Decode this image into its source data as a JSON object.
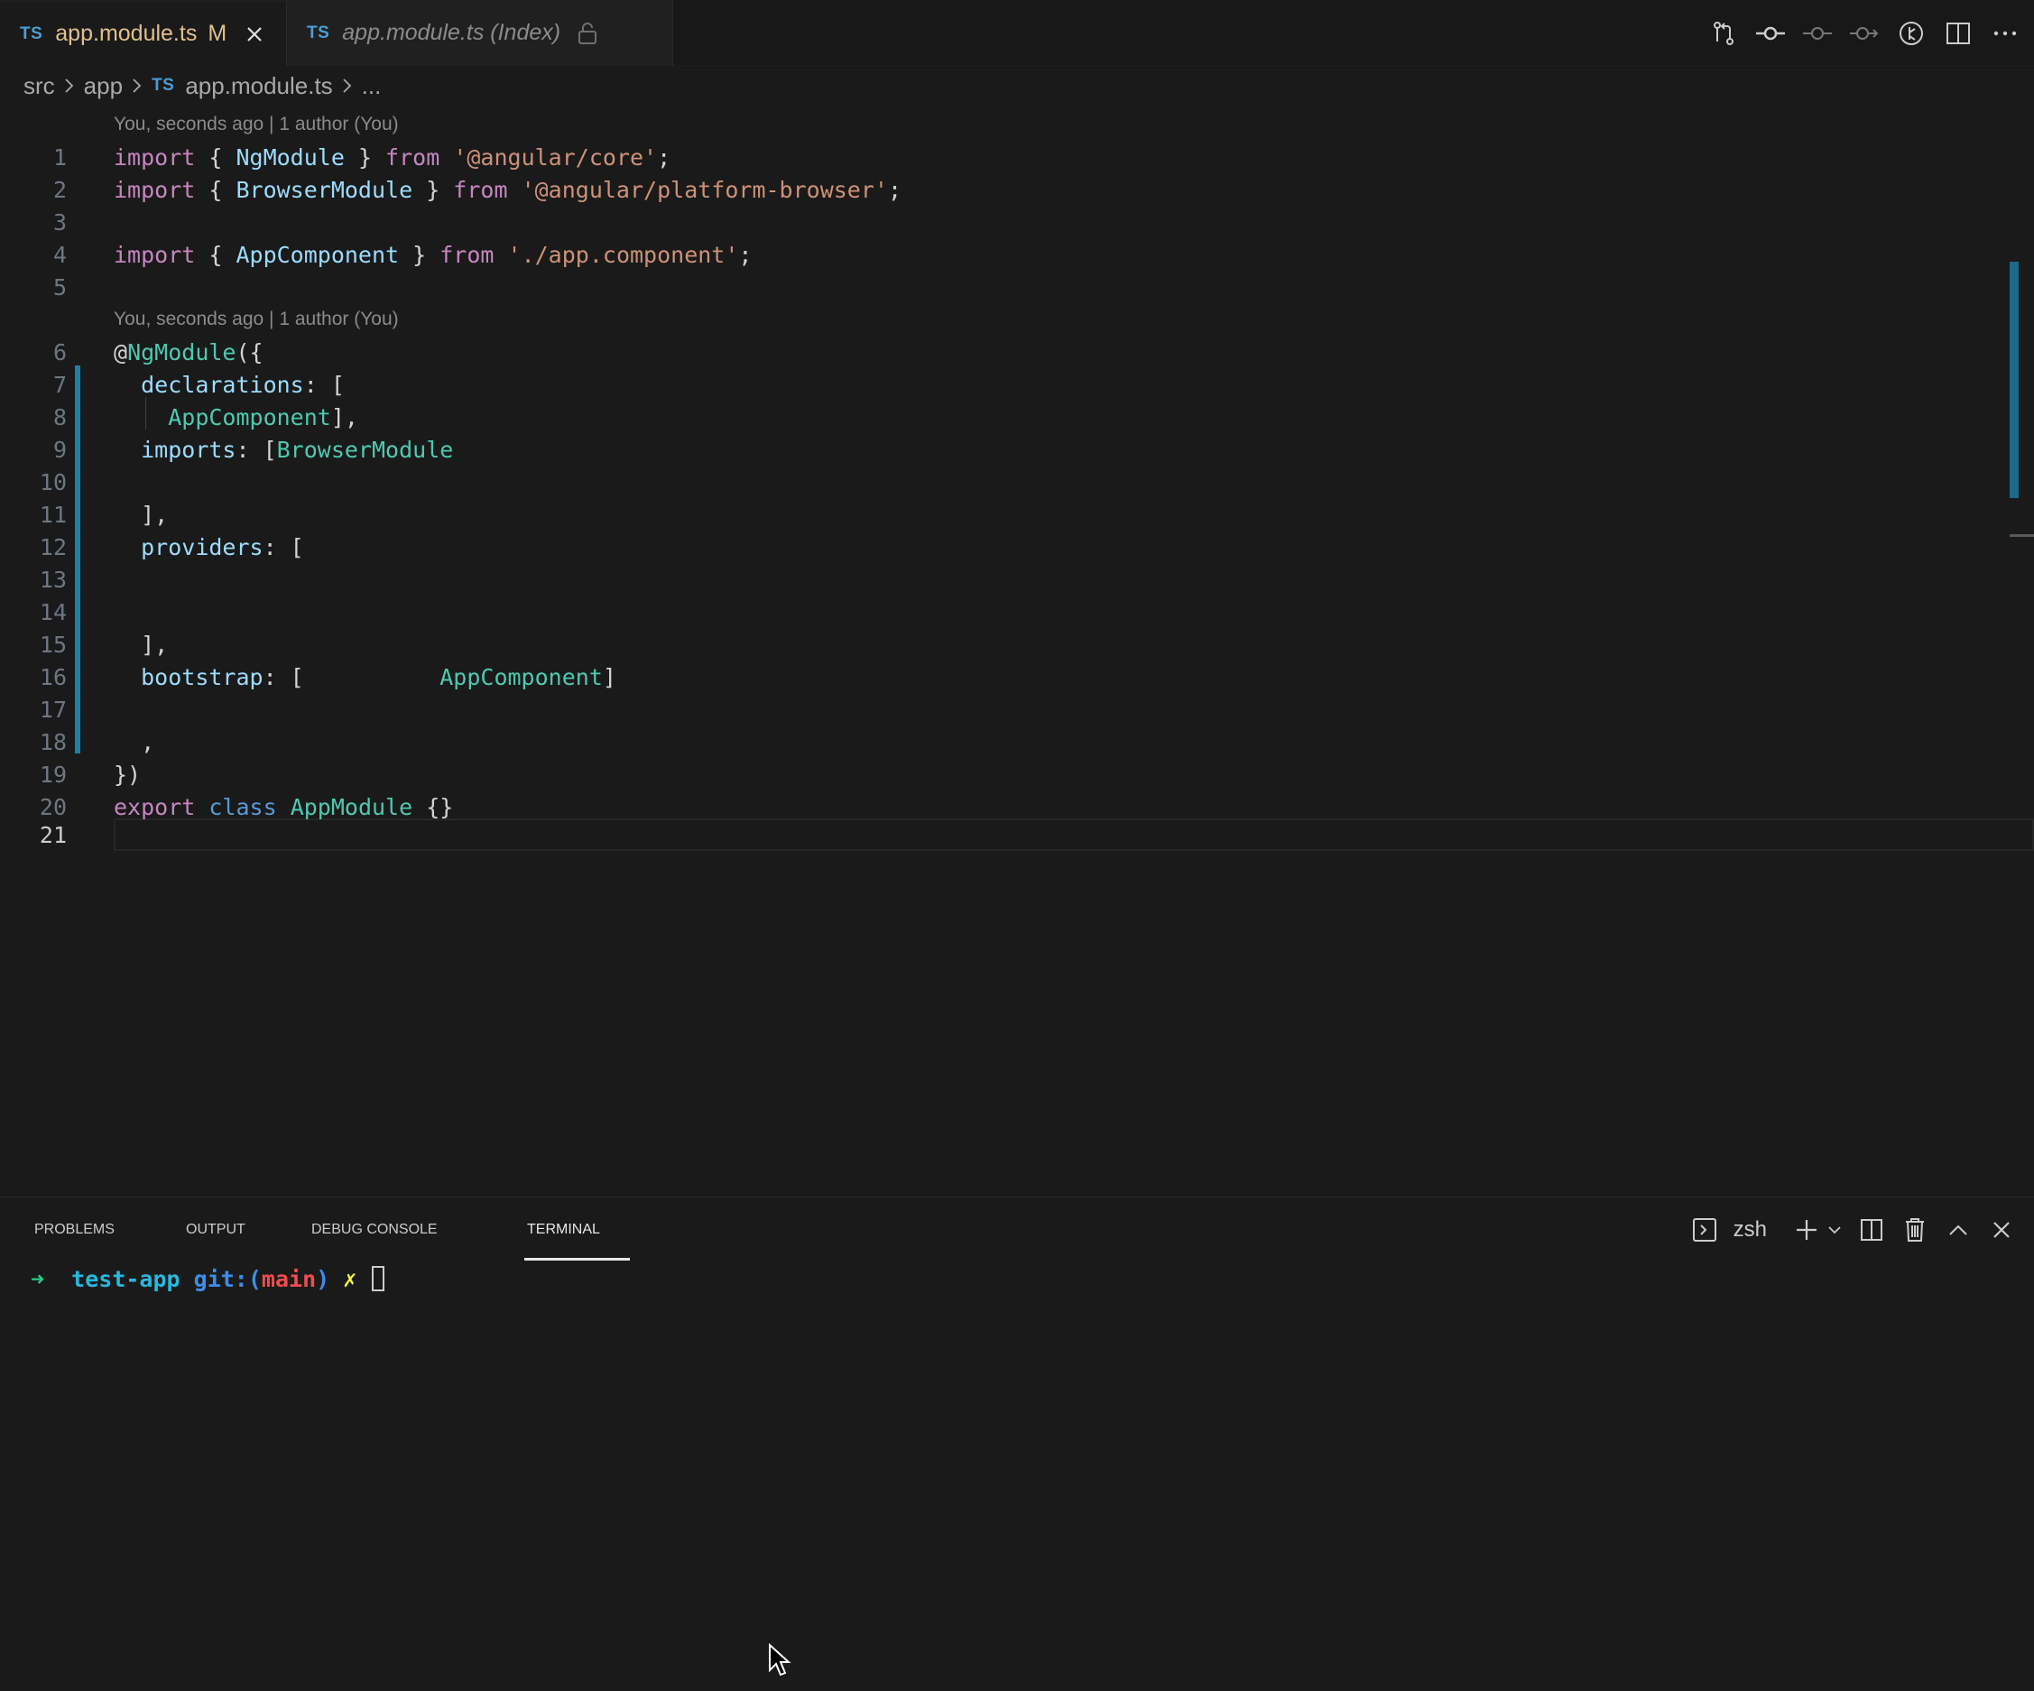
{
  "tabs": [
    {
      "lang": "TS",
      "title": "app.module.ts",
      "status": "M"
    },
    {
      "lang": "TS",
      "title": "app.module.ts (Index)"
    }
  ],
  "breadcrumb": {
    "items": [
      "src",
      "app"
    ],
    "file_lang": "TS",
    "file": "app.module.ts",
    "more": "..."
  },
  "editor": {
    "blame1": "You, seconds ago | 1 author (You)",
    "blame2": "You, seconds ago | 1 author (You)",
    "lines": [
      "1",
      "2",
      "3",
      "4",
      "5",
      "6",
      "7",
      "8",
      "9",
      "10",
      "11",
      "12",
      "13",
      "14",
      "15",
      "16",
      "17",
      "18",
      "19",
      "20",
      "21"
    ],
    "code": {
      "l1": {
        "a": "import",
        "b": " { ",
        "c": "NgModule",
        "d": " } ",
        "e": "from",
        "f": " ",
        "g": "'@angular/core'",
        "h": ";"
      },
      "l2": {
        "a": "import",
        "b": " { ",
        "c": "BrowserModule",
        "d": " } ",
        "e": "from",
        "f": " ",
        "g": "'@angular/platform-browser'",
        "h": ";"
      },
      "l4": {
        "a": "import",
        "b": " { ",
        "c": "AppComponent",
        "d": " } ",
        "e": "from",
        "f": " ",
        "g": "'./app.component'",
        "h": ";"
      },
      "l6": {
        "a": "@",
        "b": "NgModule",
        "c": "({"
      },
      "l7": {
        "a": "  ",
        "b": "declarations",
        "c": ": ["
      },
      "l8": {
        "a": "    ",
        "b": "AppComponent",
        "c": "],"
      },
      "l9": {
        "a": "  ",
        "b": "imports",
        "c": ": [",
        "d": "BrowserModule"
      },
      "l11": {
        "a": "  ],"
      },
      "l12": {
        "a": "  ",
        "b": "providers",
        "c": ": ["
      },
      "l15": {
        "a": "  ],"
      },
      "l16": {
        "a": "  ",
        "b": "bootstrap",
        "c": ": [          ",
        "d": "AppComponent",
        "e": "]"
      },
      "l18": {
        "a": "  ,"
      },
      "l19": {
        "a": "})"
      },
      "l20": {
        "a": "export",
        "b": " ",
        "c": "class",
        "d": " ",
        "e": "AppModule",
        "f": " {}"
      }
    }
  },
  "panel": {
    "tabs": [
      "PROBLEMS",
      "OUTPUT",
      "DEBUG CONSOLE",
      "TERMINAL"
    ],
    "active_tab": "TERMINAL",
    "shell": "zsh"
  },
  "terminal": {
    "arrow": "➜",
    "dir": "test-app",
    "git_label": "git:(",
    "branch": "main",
    "git_close": ")",
    "dirty": "✗"
  },
  "colors": {
    "keyword": "#c586c0",
    "identifier": "#9cdcfe",
    "class": "#4ec9b0",
    "string": "#ce9178",
    "modified": "#e2c08d",
    "gutter_modified": "#1b81a8"
  }
}
